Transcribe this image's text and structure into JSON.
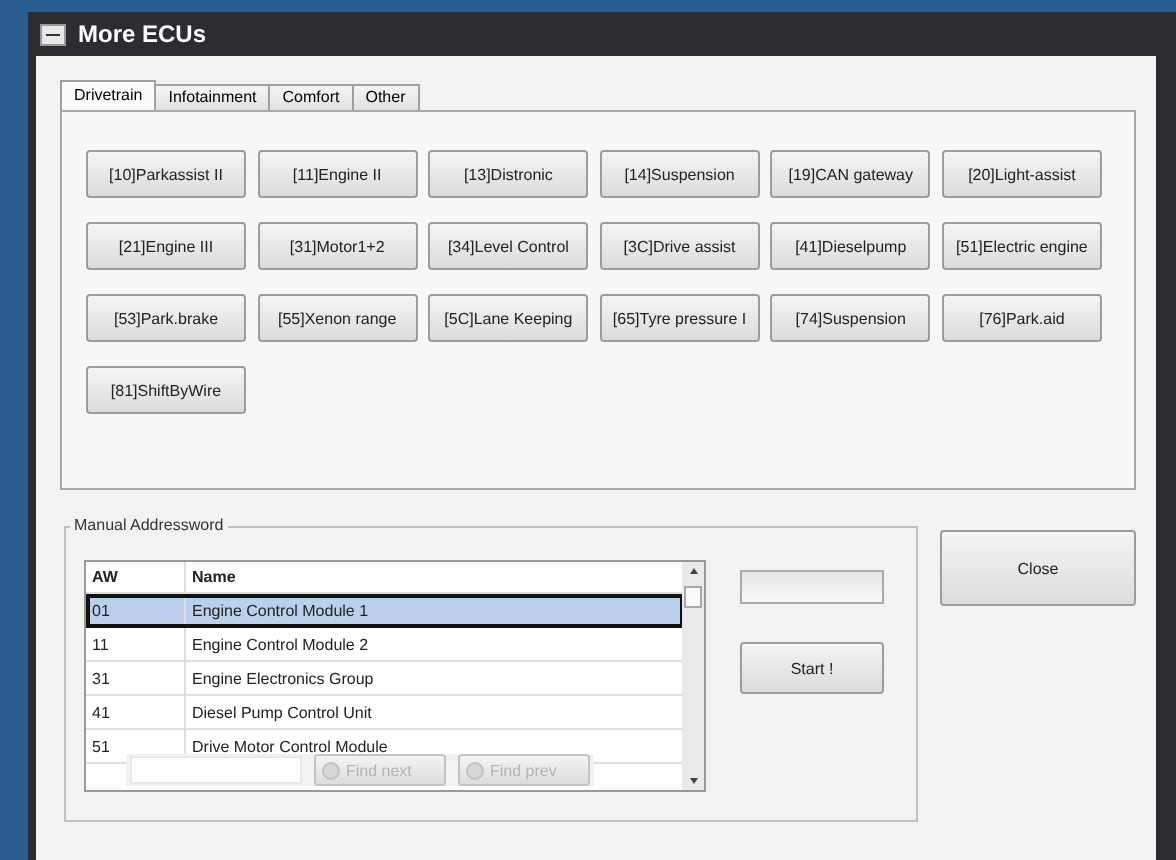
{
  "window": {
    "title": "More ECUs"
  },
  "tabs": [
    {
      "label": "Drivetrain",
      "selected": true
    },
    {
      "label": "Infotainment",
      "selected": false
    },
    {
      "label": "Comfort",
      "selected": false
    },
    {
      "label": "Other",
      "selected": false
    }
  ],
  "ecu_buttons": [
    "[10]Parkassist II",
    "[11]Engine II",
    "[13]Distronic",
    "[14]Suspension",
    "[19]CAN gateway",
    "[20]Light-assist",
    "[21]Engine III",
    "[31]Motor1+2",
    "[34]Level Control",
    "[3C]Drive assist",
    "[41]Dieselpump",
    "[51]Electric engine",
    "[53]Park.brake",
    "[55]Xenon range",
    "[5C]Lane Keeping",
    "[65]Tyre pressure I",
    "[74]Suspension",
    "[76]Park.aid",
    "[81]ShiftByWire"
  ],
  "manual_addressword": {
    "title": "Manual Addressword",
    "table": {
      "columns": [
        "AW",
        "Name"
      ],
      "rows": [
        {
          "aw": "01",
          "name": "Engine Control Module 1",
          "selected": true
        },
        {
          "aw": "11",
          "name": "Engine Control Module 2",
          "selected": false
        },
        {
          "aw": "31",
          "name": "Engine Electronics Group",
          "selected": false
        },
        {
          "aw": "41",
          "name": "Diesel Pump Control Unit",
          "selected": false
        },
        {
          "aw": "51",
          "name": "Drive Motor Control Module",
          "selected": false
        }
      ]
    },
    "find_buttons": [
      {
        "label": "Find next",
        "disabled": true
      },
      {
        "label": "Find prev",
        "disabled": true
      }
    ]
  },
  "start_button": "Start !",
  "close_button": "Close"
}
